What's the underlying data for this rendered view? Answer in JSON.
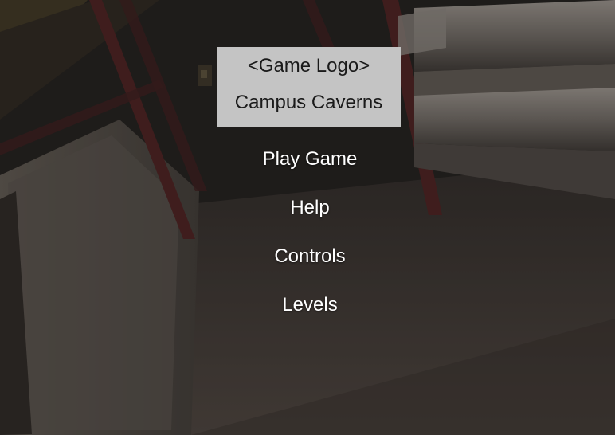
{
  "logo": {
    "placeholder": "<Game Logo>",
    "title": "Campus Caverns",
    "background": "#c4c4c4"
  },
  "menu": {
    "items": [
      {
        "label": "Play Game"
      },
      {
        "label": "Help"
      },
      {
        "label": "Controls"
      },
      {
        "label": "Levels"
      }
    ]
  },
  "colors": {
    "menu_text": "#ffffff",
    "overlay": "#1e1c1a"
  }
}
